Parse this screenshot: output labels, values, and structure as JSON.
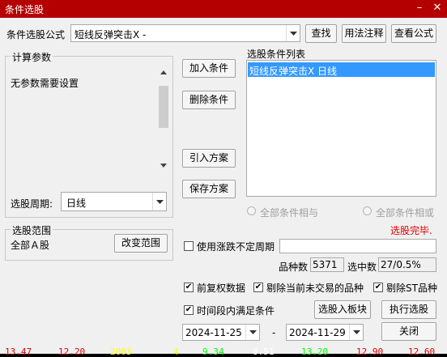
{
  "window": {
    "title": "条件选股",
    "minimize": "–",
    "close": "✕"
  },
  "formula": {
    "label": "条件选股公式",
    "value": "短线反弹突击X -",
    "find": "查找",
    "usage": "用法注释",
    "view": "查看公式"
  },
  "params": {
    "legend": "计算参数",
    "text": "无参数需要设置"
  },
  "period": {
    "label": "选股周期:",
    "value": "日线"
  },
  "actions": {
    "add": "加入条件",
    "remove": "删除条件",
    "import": "引入方案",
    "save": "保存方案"
  },
  "conditions": {
    "title": "选股条件列表",
    "items": [
      "短线反弹突击X  日线"
    ]
  },
  "logic": {
    "and": "全部条件相与",
    "or": "全部条件相或"
  },
  "status": "选股完毕.",
  "range": {
    "legend": "选股范围",
    "value": "全部Ａ股",
    "change": "改变范围"
  },
  "uncertain": {
    "label": "使用涨跌不定周期",
    "checked": false,
    "value": ""
  },
  "counts": {
    "total_label": "品种数",
    "total": "5371",
    "selected_label": "选中数",
    "selected": "27/0.5%"
  },
  "options": {
    "adjust": {
      "label": "前复权数据",
      "checked": true
    },
    "exclude_untraded": {
      "label": "剔除当前未交易的品种",
      "checked": true
    },
    "exclude_st": {
      "label": "剔除ST品种",
      "checked": true
    },
    "time_range": {
      "label": "时间段内满足条件",
      "checked": true
    }
  },
  "buttons": {
    "to_block": "选股入板块",
    "run": "执行选股",
    "close": "关闭"
  },
  "dates": {
    "start": "2024-11-25",
    "sep": "-",
    "end": "2024-11-29"
  },
  "ticker": [
    "13.47",
    "12.20",
    "2003",
    "4",
    "9.34",
    "8.51",
    "13.20",
    "12.90",
    "12.60"
  ],
  "colors": {
    "title_bg": "#b40000",
    "selected_bg": "#3399ff",
    "status": "#e00000"
  }
}
